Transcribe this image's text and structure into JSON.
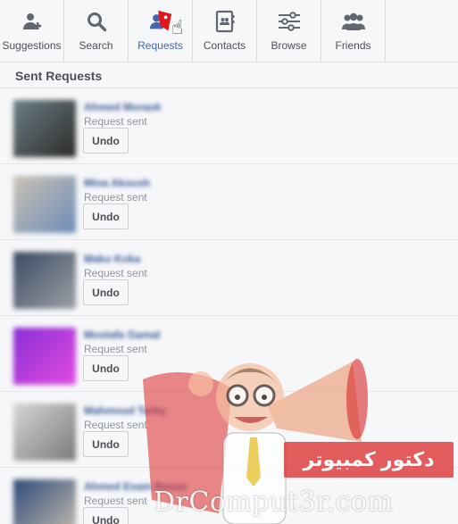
{
  "nav": {
    "items": [
      {
        "label": "Suggestions",
        "icon": "add-person-icon"
      },
      {
        "label": "Search",
        "icon": "search-icon"
      },
      {
        "label": "Requests",
        "icon": "friend-requests-icon"
      },
      {
        "label": "Contacts",
        "icon": "contacts-book-icon"
      },
      {
        "label": "Browse",
        "icon": "sliders-icon"
      },
      {
        "label": "Friends",
        "icon": "people-icon"
      }
    ],
    "active_color": "#4267b2"
  },
  "section": {
    "title": "Sent Requests"
  },
  "requests": [
    {
      "name": "Ahmed Moraok",
      "status": "Request sent",
      "undo": "Undo",
      "avatar_colors": [
        "#6b7f86",
        "#2d2b2a"
      ]
    },
    {
      "name": "Mina Akoush",
      "status": "Request sent",
      "undo": "Undo",
      "avatar_colors": [
        "#c9c3b4",
        "#6d8bb8"
      ]
    },
    {
      "name": "Mako Koka",
      "status": "Request sent",
      "undo": "Undo",
      "avatar_colors": [
        "#3c4a63",
        "#9aa0a6"
      ]
    },
    {
      "name": "Mostafa Gamal",
      "status": "Request sent",
      "undo": "Undo",
      "avatar_colors": [
        "#8b2fd6",
        "#e24be0"
      ]
    },
    {
      "name": "Mahmoud Turky",
      "status": "Request sent",
      "undo": "Undo",
      "avatar_colors": [
        "#d6d6d6",
        "#7a7a7a"
      ]
    },
    {
      "name": "Ahmed Esam Rosas",
      "status": "Request sent",
      "undo": "Undo",
      "avatar_colors": [
        "#2f4a7a",
        "#c7bfb0"
      ]
    }
  ],
  "watermark": {
    "arabic": "دكتور كمبيوتر",
    "latin": "DrComput3r.com"
  }
}
